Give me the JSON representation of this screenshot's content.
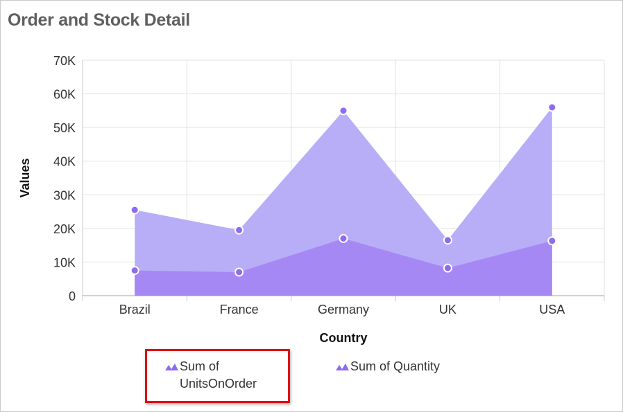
{
  "title": "Order and Stock Detail",
  "chart_data": {
    "type": "area",
    "title": "Order and Stock Detail",
    "xlabel": "Country",
    "ylabel": "Values",
    "categories": [
      "Brazil",
      "France",
      "Germany",
      "UK",
      "USA"
    ],
    "ylim": [
      0,
      70000
    ],
    "yticks": [
      0,
      10000,
      20000,
      30000,
      40000,
      50000,
      60000,
      70000
    ],
    "ytick_labels": [
      "0",
      "10K",
      "20K",
      "30K",
      "40K",
      "50K",
      "60K",
      "70K"
    ],
    "grid": true,
    "legend_position": "bottom",
    "series": [
      {
        "name": "Sum of Quantity",
        "values": [
          25500,
          19500,
          55000,
          16500,
          56000
        ],
        "color": "#b8aef7",
        "marker": "#8d6cf2"
      },
      {
        "name": "Sum of UnitsOnOrder",
        "values": [
          7500,
          7000,
          17000,
          8200,
          16300
        ],
        "color": "#a688f5",
        "marker": "#8d6cf2"
      }
    ]
  },
  "legend": [
    {
      "label": "Sum of UnitsOnOrder",
      "icon": "area-icon",
      "color": "#8d6cf2",
      "highlighted": true
    },
    {
      "label": "Sum of Quantity",
      "icon": "area-icon",
      "color": "#8d6cf2",
      "highlighted": false
    }
  ]
}
